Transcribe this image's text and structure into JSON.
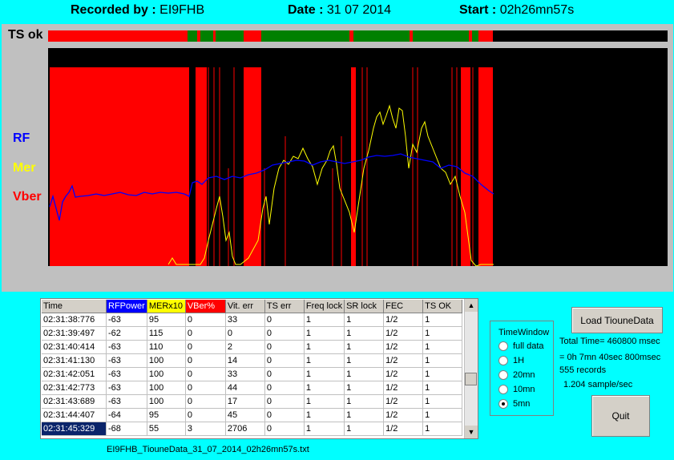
{
  "header": {
    "recorded_label": "Recorded by :",
    "recorded_value": "EI9FHB",
    "date_label": "Date :",
    "date_value": "31 07 2014",
    "start_label": "Start :",
    "start_value": "02h26mn57s"
  },
  "legend": {
    "ts": "TS ok",
    "rf": "RF",
    "mer": "Mer",
    "vber": "Vber"
  },
  "colors": {
    "rf": "#0000ff",
    "mer": "#ffff00",
    "vber": "#ff0000",
    "ts_ok": "#008000",
    "ts_bad": "#ff0000",
    "bg": "#00ffff"
  },
  "table": {
    "columns": [
      "Time",
      "RFPower",
      "MERx10",
      "VBer%",
      "Vit. err",
      "TS err",
      "Freq lock",
      "SR lock",
      "FEC",
      "TS OK"
    ],
    "rows": [
      [
        "02:31:38:776",
        "-63",
        "95",
        "0",
        "33",
        "0",
        "1",
        "1",
        "1/2",
        "1"
      ],
      [
        "02:31:39:497",
        "-62",
        "115",
        "0",
        "0",
        "0",
        "1",
        "1",
        "1/2",
        "1"
      ],
      [
        "02:31:40:414",
        "-63",
        "110",
        "0",
        "2",
        "0",
        "1",
        "1",
        "1/2",
        "1"
      ],
      [
        "02:31:41:130",
        "-63",
        "100",
        "0",
        "14",
        "0",
        "1",
        "1",
        "1/2",
        "1"
      ],
      [
        "02:31:42:051",
        "-63",
        "100",
        "0",
        "33",
        "0",
        "1",
        "1",
        "1/2",
        "1"
      ],
      [
        "02:31:42:773",
        "-63",
        "100",
        "0",
        "44",
        "0",
        "1",
        "1",
        "1/2",
        "1"
      ],
      [
        "02:31:43:689",
        "-63",
        "100",
        "0",
        "17",
        "0",
        "1",
        "1",
        "1/2",
        "1"
      ],
      [
        "02:31:44:407",
        "-64",
        "95",
        "0",
        "45",
        "0",
        "1",
        "1",
        "1/2",
        "1"
      ],
      [
        "02:31:45:329",
        "-68",
        "55",
        "3",
        "2706",
        "0",
        "1",
        "1",
        "1/2",
        "1"
      ]
    ]
  },
  "timewindow": {
    "title": "TimeWindow",
    "options": [
      "full data",
      "1H",
      "20mn",
      "10mn",
      "5mn"
    ],
    "selected": "5mn"
  },
  "buttons": {
    "load": "Load TiouneData",
    "quit": "Quit"
  },
  "info": {
    "total_time": "Total Time= 460800 msec",
    "duration": "= 0h 7mn 40sec 800msec",
    "records": "555 records",
    "rate": "1.204 sample/sec"
  },
  "filename": "EI9FHB_TiouneData_31_07_2014_02h26mn57s.txt"
}
